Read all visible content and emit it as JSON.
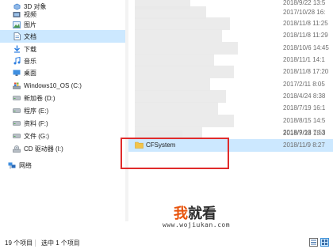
{
  "sidebar": {
    "items": [
      {
        "label": "3D 对象",
        "icon": "cube-icon"
      },
      {
        "label": "视频",
        "icon": "video-icon"
      },
      {
        "label": "图片",
        "icon": "picture-icon"
      },
      {
        "label": "文档",
        "icon": "document-icon",
        "selected": true
      },
      {
        "label": "下载",
        "icon": "download-icon"
      },
      {
        "label": "音乐",
        "icon": "music-icon"
      },
      {
        "label": "桌面",
        "icon": "desktop-icon"
      },
      {
        "label": "Windows10_OS (C:)",
        "icon": "os-drive-icon"
      },
      {
        "label": "新加卷 (D:)",
        "icon": "drive-icon"
      },
      {
        "label": "程序 (E:)",
        "icon": "drive-icon"
      },
      {
        "label": "资料 (F:)",
        "icon": "drive-icon"
      },
      {
        "label": "文件 (G:)",
        "icon": "drive-icon"
      },
      {
        "label": "CD 驱动器 (I:)",
        "icon": "cd-drive-icon"
      },
      {
        "label": "网络",
        "icon": "network-icon"
      }
    ]
  },
  "files": {
    "rows": [
      {
        "date": "2018/9/22 13:5"
      },
      {
        "date": "2017/10/28 16:"
      },
      {
        "date": "2018/11/8 11:25"
      },
      {
        "date": "2018/11/8 11:29"
      },
      {
        "date": "2018/10/6 14:45"
      },
      {
        "date": "2018/11/1 14:1"
      },
      {
        "date": "2018/11/8 17:20"
      },
      {
        "date": "2017/2/11 8:05"
      },
      {
        "date": "2018/4/24 8:38"
      },
      {
        "date": "2018/7/19 16:1"
      },
      {
        "date": "2018/8/15 14:5"
      },
      {
        "date": "2018/9/13 7:53"
      },
      {
        "date": "2018/7/28 15:3"
      }
    ],
    "selected": {
      "name": "CFSystem",
      "date": "2018/11/9 8:27"
    }
  },
  "watermark": {
    "logo_a": "我",
    "logo_b": "就看",
    "url": "www.wojiukan.com"
  },
  "status": {
    "count": "19 个项目",
    "selection": "选中 1 个项目"
  },
  "colors": {
    "selection": "#cce8ff",
    "highlight": "#e02b2b",
    "folder": "#f2c44a",
    "accent": "#0078d7"
  }
}
